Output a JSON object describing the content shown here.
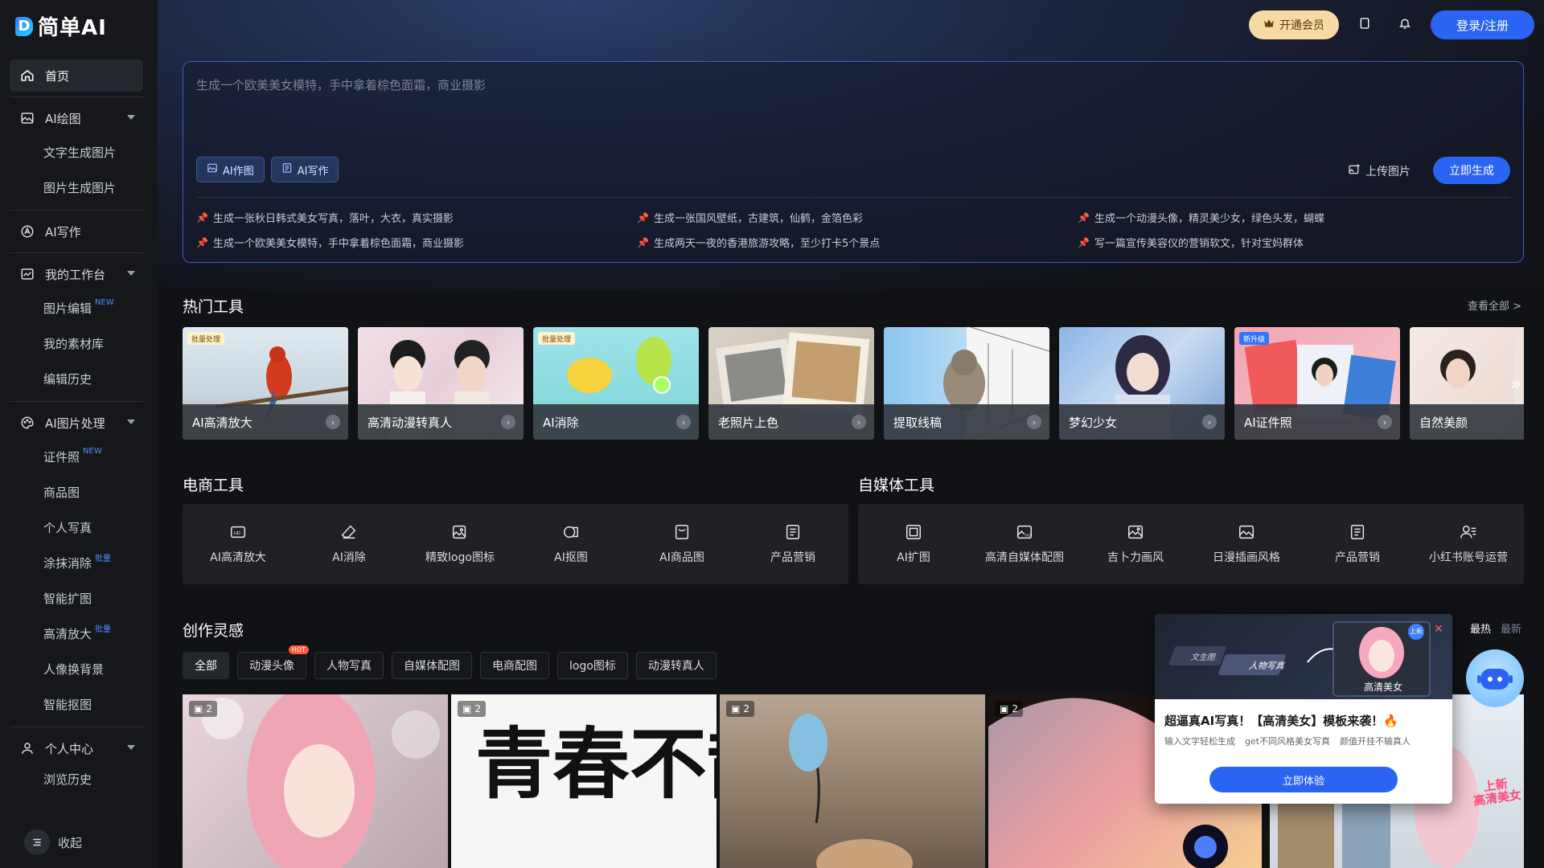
{
  "brand": {
    "logo_mark": "D",
    "name": "简单AI"
  },
  "sidebar": {
    "home": "首页",
    "ai_drawing": {
      "label": "AI绘图",
      "items": [
        "文字生成图片",
        "图片生成图片"
      ]
    },
    "ai_writing": "AI写作",
    "workbench": {
      "label": "我的工作台",
      "items": [
        {
          "label": "图片编辑",
          "tag": "NEW"
        },
        {
          "label": "我的素材库",
          "tag": ""
        },
        {
          "label": "编辑历史",
          "tag": ""
        }
      ]
    },
    "image_proc": {
      "label": "AI图片处理",
      "items": [
        {
          "label": "证件照",
          "tag": "NEW"
        },
        {
          "label": "商品图",
          "tag": ""
        },
        {
          "label": "个人写真",
          "tag": ""
        },
        {
          "label": "涂抹消除",
          "tag": "批量"
        },
        {
          "label": "智能扩图",
          "tag": ""
        },
        {
          "label": "高清放大",
          "tag": "批量"
        },
        {
          "label": "人像换背景",
          "tag": ""
        },
        {
          "label": "智能抠图",
          "tag": ""
        }
      ]
    },
    "personal": {
      "label": "个人中心",
      "items": [
        "浏览历史"
      ]
    },
    "collapse": "收起"
  },
  "topbar": {
    "vip": "开通会员",
    "login": "登录/注册"
  },
  "prompt": {
    "placeholder": "生成一个欧美美女模特，手中拿着棕色面霜，商业摄影",
    "mode_draw": "AI作图",
    "mode_write": "AI写作",
    "upload": "上传图片",
    "generate": "立即生成",
    "suggestions": [
      "生成一张秋日韩式美女写真，落叶，大衣，真实摄影",
      "生成一张国风壁纸，古建筑，仙鹤，金箔色彩",
      "生成一个动漫头像，精灵美少女，绿色头发，蝴蝶",
      "生成一个欧美美女模特，手中拿着棕色面霜，商业摄影",
      "生成两天一夜的香港旅游攻略，至少打卡5个景点",
      "写一篇宣传美容仪的营销软文，针对宝妈群体"
    ]
  },
  "hot_tools": {
    "title": "热门工具",
    "see_all": "查看全部 >",
    "items": [
      {
        "label": "AI高清放大",
        "badge": "批量处理"
      },
      {
        "label": "高清动漫转真人",
        "badge": ""
      },
      {
        "label": "AI消除",
        "badge": "批量处理"
      },
      {
        "label": "老照片上色",
        "badge": ""
      },
      {
        "label": "提取线稿",
        "badge": ""
      },
      {
        "label": "梦幻少女",
        "badge": ""
      },
      {
        "label": "AI证件照",
        "badge": "新升级"
      },
      {
        "label": "自然美颜",
        "badge": ""
      }
    ]
  },
  "ecommerce": {
    "title": "电商工具",
    "items": [
      "AI高清放大",
      "AI消除",
      "精致logo图标",
      "AI抠图",
      "AI商品图",
      "产品营销"
    ]
  },
  "media": {
    "title": "自媒体工具",
    "items": [
      "AI扩图",
      "高清自媒体配图",
      "吉卜力画风",
      "日漫插画风格",
      "产品营销",
      "小红书账号运营"
    ]
  },
  "inspiration": {
    "title": "创作灵感",
    "sort_hot": "最热",
    "sort_new": "最新",
    "chips": [
      "全部",
      "动漫头像",
      "人物写真",
      "自媒体配图",
      "电商配图",
      "logo图标",
      "动漫转真人"
    ],
    "hot_badge": "HOT",
    "gallery_counts": [
      "2",
      "2",
      "2",
      "2"
    ],
    "calligraphy": "青春不散"
  },
  "popup": {
    "tag1": "文生图",
    "tag2": "人物写真",
    "preview_label": "高清美女",
    "corner": "上新",
    "title": "超逼真AI写真！【高清美女】模板来袭！🔥",
    "desc": [
      "输入文字轻松生成",
      "get不同风格美女写真",
      "颜值开挂不输真人"
    ],
    "cta": "立即体验"
  },
  "promo_thumb": {
    "line1": "上新",
    "line2": "高清美女"
  }
}
